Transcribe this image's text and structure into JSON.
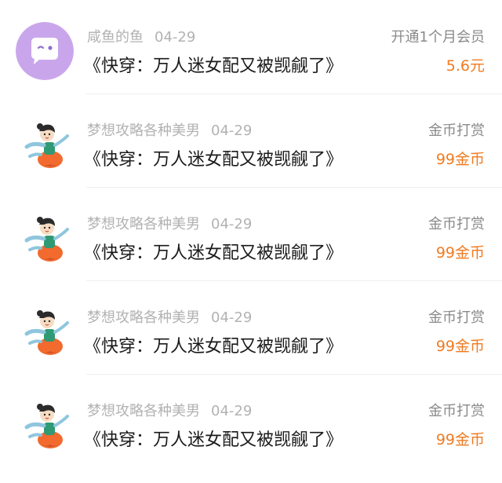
{
  "list": {
    "items": [
      {
        "user": "咸鱼的鱼",
        "date": "04-29",
        "book": "《快穿：万人迷女配又被觊觎了》",
        "action": "开通1个月会员",
        "amount": "5.6元",
        "avatar_icon": "chat-bubble-avatar-icon"
      },
      {
        "user": "梦想攻略各种美男",
        "date": "04-29",
        "book": "《快穿：万人迷女配又被觊觎了》",
        "action": "金币打赏",
        "amount": "99金币",
        "avatar_icon": "dancing-girl-avatar-icon"
      },
      {
        "user": "梦想攻略各种美男",
        "date": "04-29",
        "book": "《快穿：万人迷女配又被觊觎了》",
        "action": "金币打赏",
        "amount": "99金币",
        "avatar_icon": "dancing-girl-avatar-icon"
      },
      {
        "user": "梦想攻略各种美男",
        "date": "04-29",
        "book": "《快穿：万人迷女配又被觊觎了》",
        "action": "金币打赏",
        "amount": "99金币",
        "avatar_icon": "dancing-girl-avatar-icon"
      },
      {
        "user": "梦想攻略各种美男",
        "date": "04-29",
        "book": "《快穿：万人迷女配又被觊觎了》",
        "action": "金币打赏",
        "amount": "99金币",
        "avatar_icon": "dancing-girl-avatar-icon"
      }
    ]
  },
  "colors": {
    "amount": "#f07b21",
    "muted": "#b2b2b2",
    "title": "#1a1a1a",
    "avatar_bg": "#c9a6ec"
  }
}
